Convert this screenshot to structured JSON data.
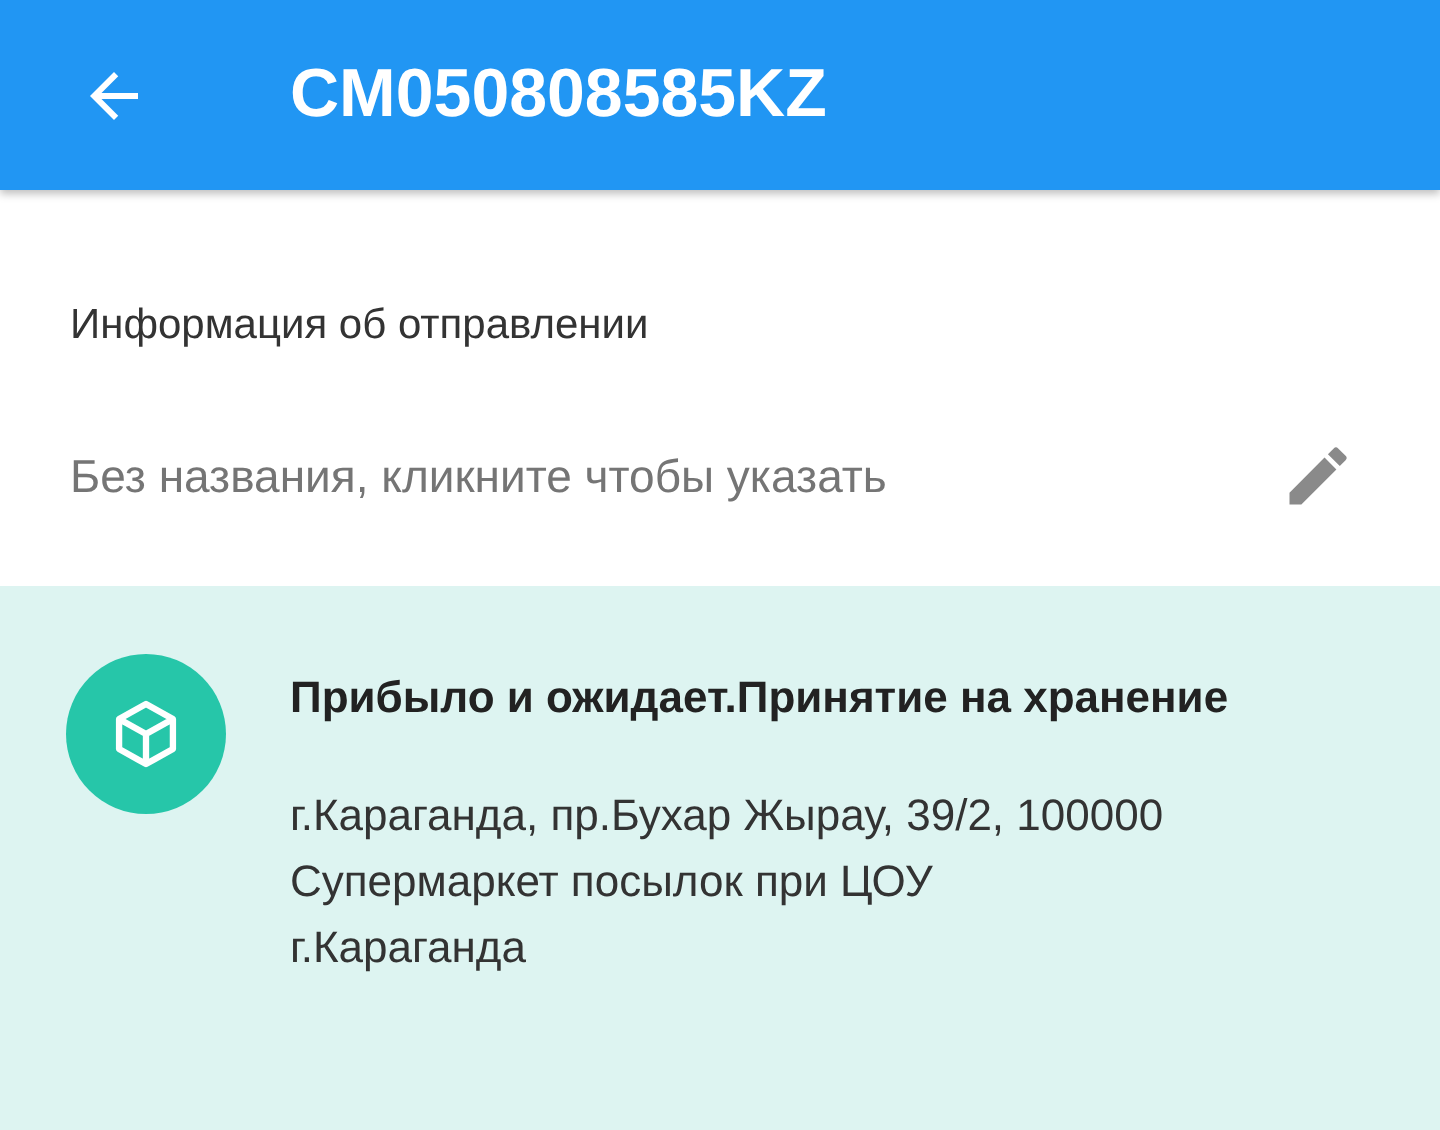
{
  "app_bar": {
    "title": "CM050808585KZ"
  },
  "info": {
    "heading": "Информация об отправлении",
    "name_placeholder": "Без названия, кликните чтобы указать"
  },
  "status": {
    "title": "Прибыло и ожидает.Принятие на хранение",
    "address": [
      "г.Караганда, пр.Бухар Жырау, 39/2, 100000",
      "Супермаркет посылок при ЦОУ",
      "г.Караганда"
    ]
  }
}
